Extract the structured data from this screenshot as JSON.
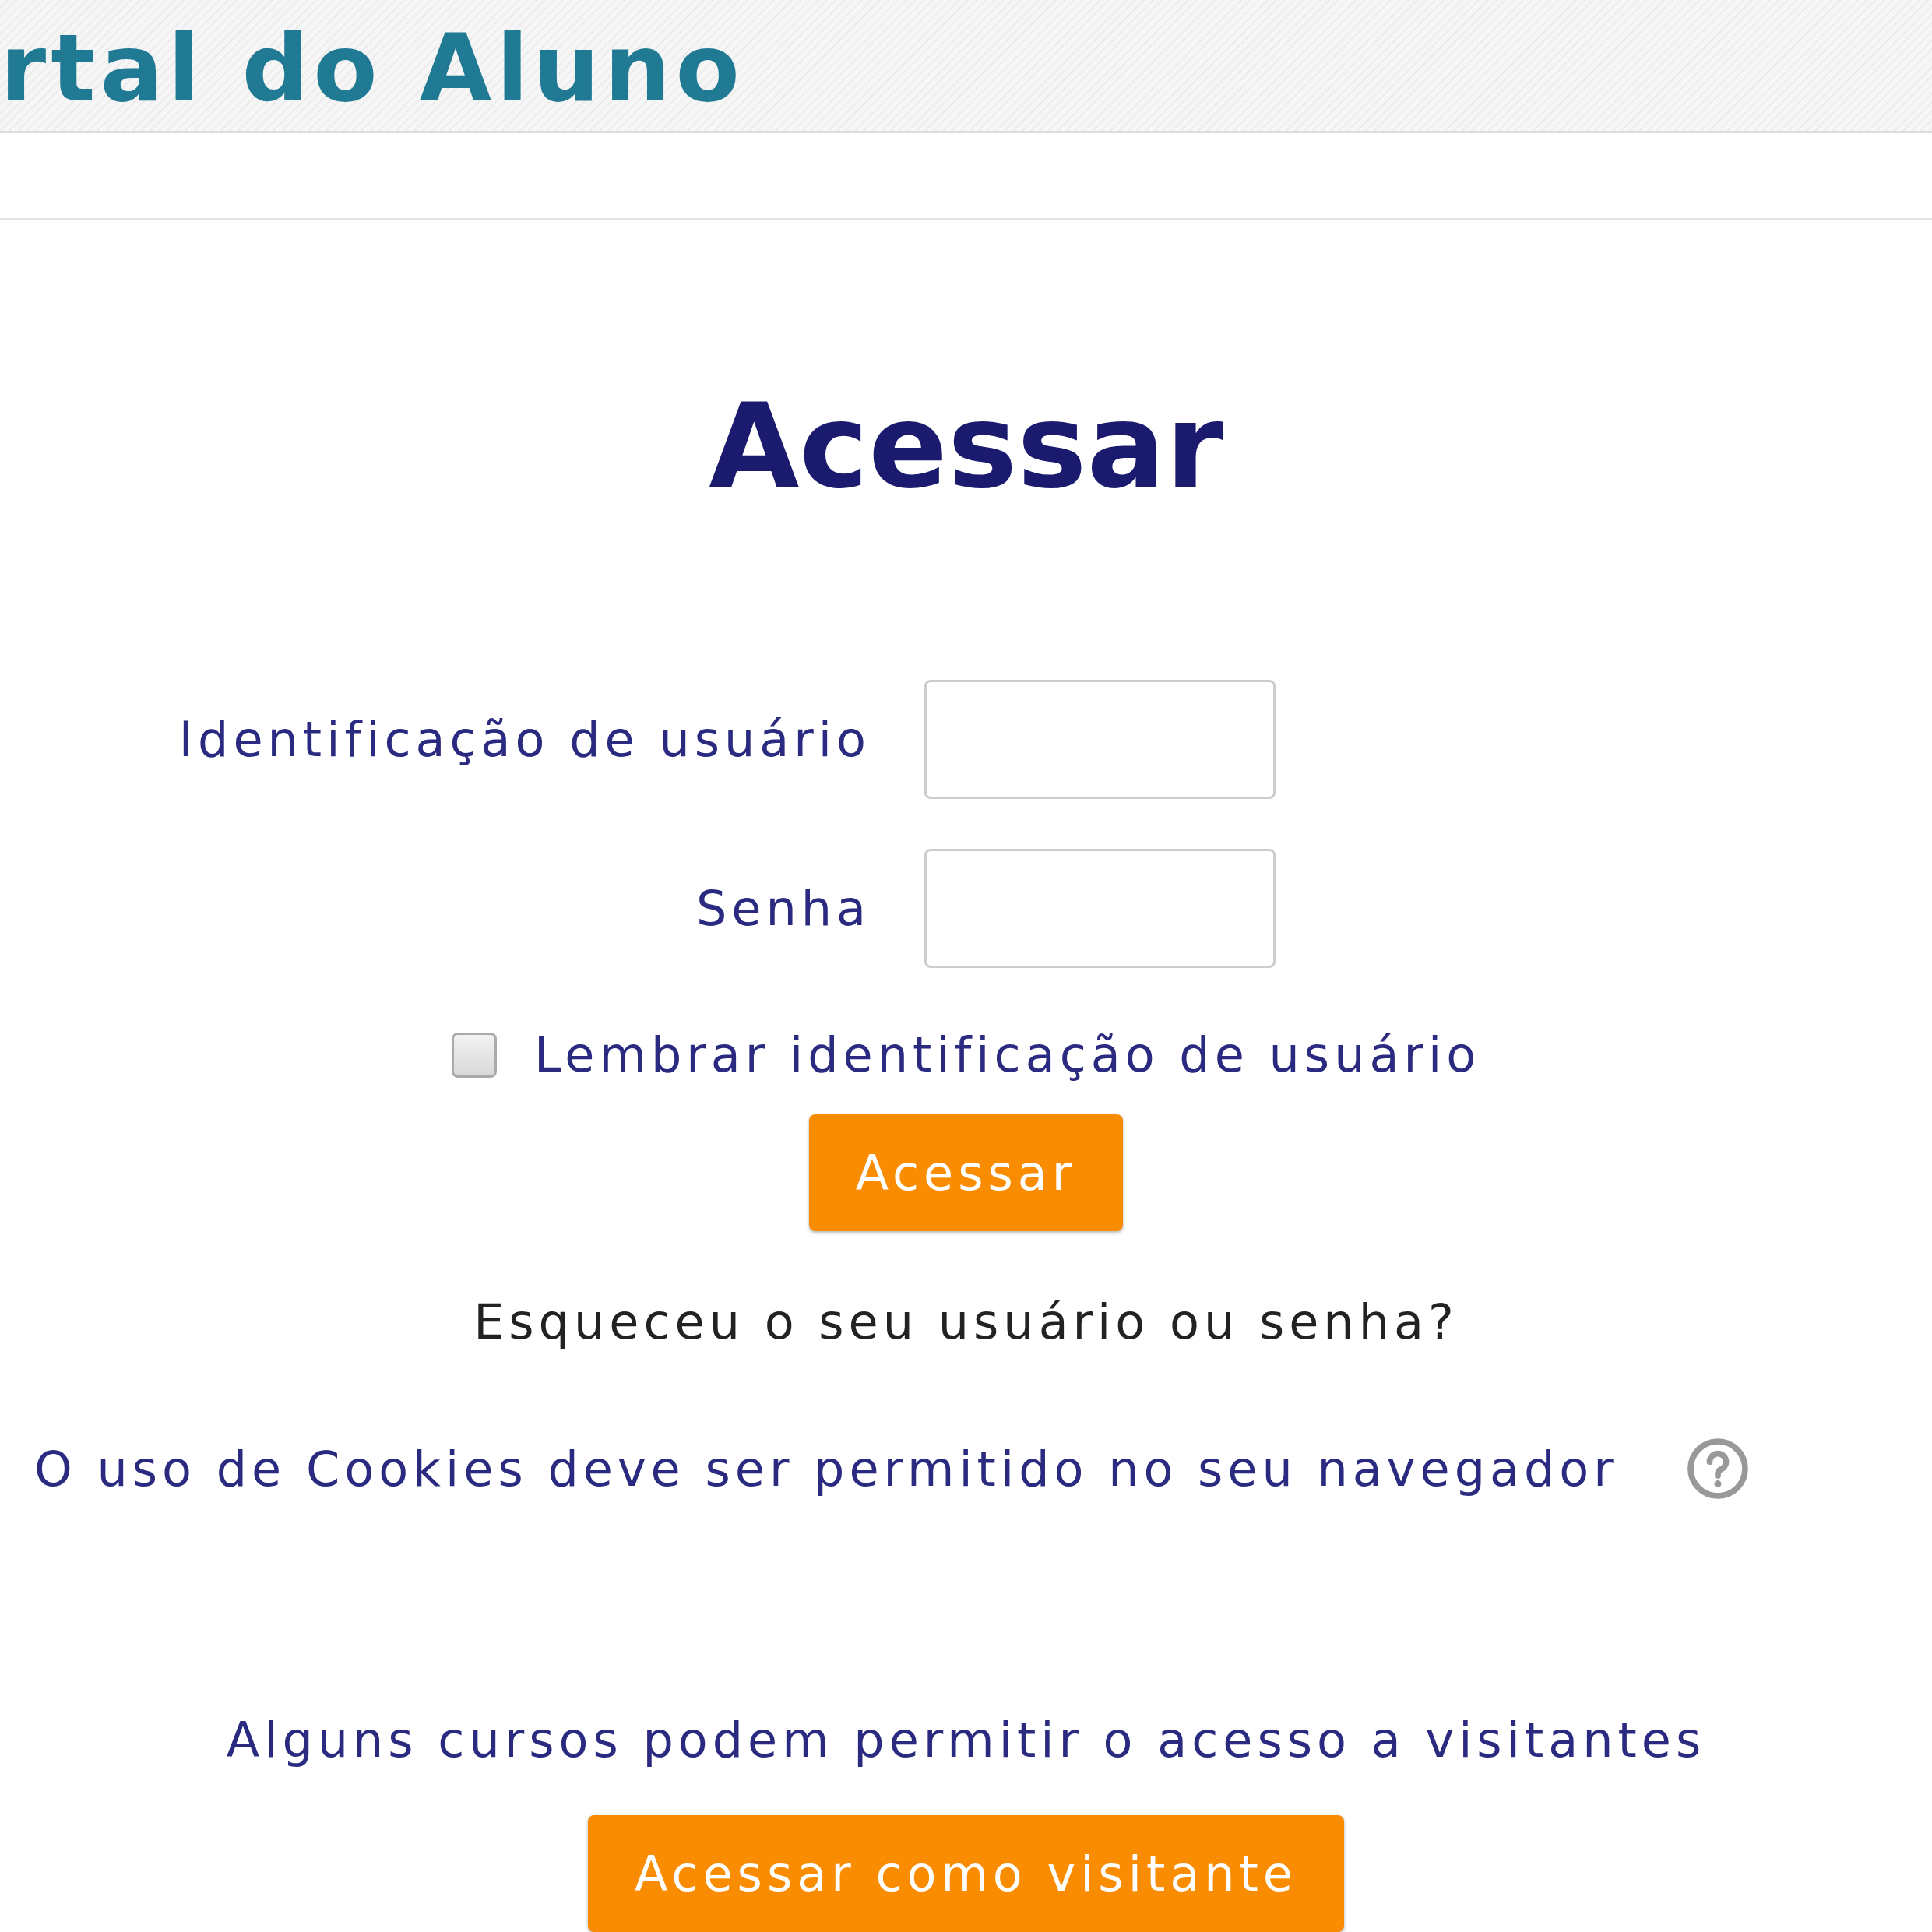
{
  "header": {
    "title": "rtal do Aluno"
  },
  "login": {
    "title": "Acessar",
    "fields": [
      {
        "label": "Identificação de usuário"
      },
      {
        "label": "Senha"
      }
    ],
    "remember": {
      "label": "Lembrar identificação de usuário",
      "checked": false
    },
    "submit": "Acessar",
    "forgot": "Esqueceu o seu usuário ou senha?",
    "cookies_notice": "O uso de Cookies deve ser permitido no seu navegador",
    "guest_notice": "Alguns cursos podem permitir o acesso a visitantes",
    "guest_button": "Acessar como visitante"
  }
}
